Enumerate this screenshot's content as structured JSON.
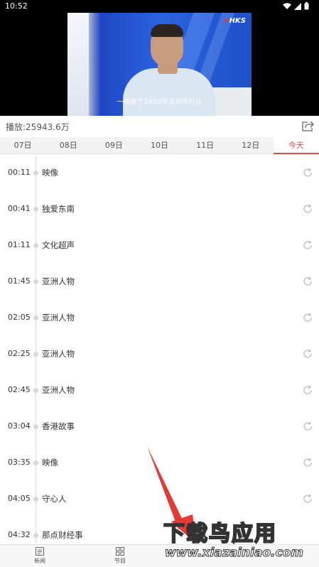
{
  "status_bar": {
    "time": "10:52"
  },
  "video": {
    "channel_logo": "HKS",
    "subtitle": "一拢做了2020年深圳市行业"
  },
  "info": {
    "play_count": "播放:25943.6万",
    "share_icon": "share-icon"
  },
  "date_tabs": [
    {
      "label": "07日"
    },
    {
      "label": "08日"
    },
    {
      "label": "09日"
    },
    {
      "label": "10日"
    },
    {
      "label": "11日"
    },
    {
      "label": "12日"
    },
    {
      "label": "今天",
      "active": true
    }
  ],
  "programs": [
    {
      "time": "00:11",
      "title": "映像"
    },
    {
      "time": "00:41",
      "title": "独爱东南"
    },
    {
      "time": "01:11",
      "title": "文化超声"
    },
    {
      "time": "01:45",
      "title": "亚洲人物"
    },
    {
      "time": "02:05",
      "title": "亚洲人物"
    },
    {
      "time": "02:25",
      "title": "亚洲人物"
    },
    {
      "time": "02:45",
      "title": "亚洲人物"
    },
    {
      "time": "03:04",
      "title": "香港故事"
    },
    {
      "time": "03:35",
      "title": "映像"
    },
    {
      "time": "04:05",
      "title": "守心人"
    },
    {
      "time": "04:32",
      "title": "那点财经事"
    }
  ],
  "bottom_nav": [
    {
      "label": "新闻",
      "icon": "news-icon"
    },
    {
      "label": "节目",
      "icon": "grid-icon"
    }
  ],
  "watermark": {
    "text": "下载鸟应用",
    "url": "www.xiazainiao.com"
  },
  "colors": {
    "accent": "#e54b4b",
    "timeline": "#dcdcdc"
  }
}
